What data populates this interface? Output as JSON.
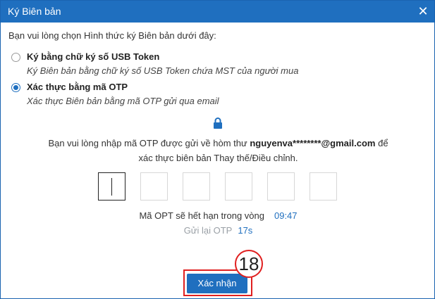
{
  "dialog": {
    "title": "Ký Biên bản",
    "close_icon": "close-icon"
  },
  "instruction": "Bạn vui lòng chọn Hình thức ký Biên bản dưới đây:",
  "options": [
    {
      "label": "Ký bằng chữ ký số USB Token",
      "description": "Ký Biên bản bằng chữ ký số USB Token chứa MST của người mua",
      "selected": false
    },
    {
      "label": "Xác thực bằng mã OTP",
      "description": "Xác thực Biên bản bằng mã OTP gửi qua email",
      "selected": true
    }
  ],
  "otp": {
    "icon": "lock-icon",
    "message_prefix": "Bạn vui lòng nhập mã OTP được gửi về hòm thư",
    "email": "nguyenva********@gmail.com",
    "message_suffix": "để",
    "message_line2": "xác thực biên bản Thay thế/Điều chỉnh.",
    "digits": [
      "",
      "",
      "",
      "",
      "",
      ""
    ],
    "expire_label": "Mã OPT sẽ hết hạn trong vòng",
    "expire_time": "09:47",
    "resend_label": "Gửi lại OTP",
    "resend_countdown": "17s"
  },
  "confirm_button": "Xác nhận",
  "step_badge": "18",
  "colors": {
    "primary": "#1f6fbf",
    "highlight": "#e02020"
  }
}
